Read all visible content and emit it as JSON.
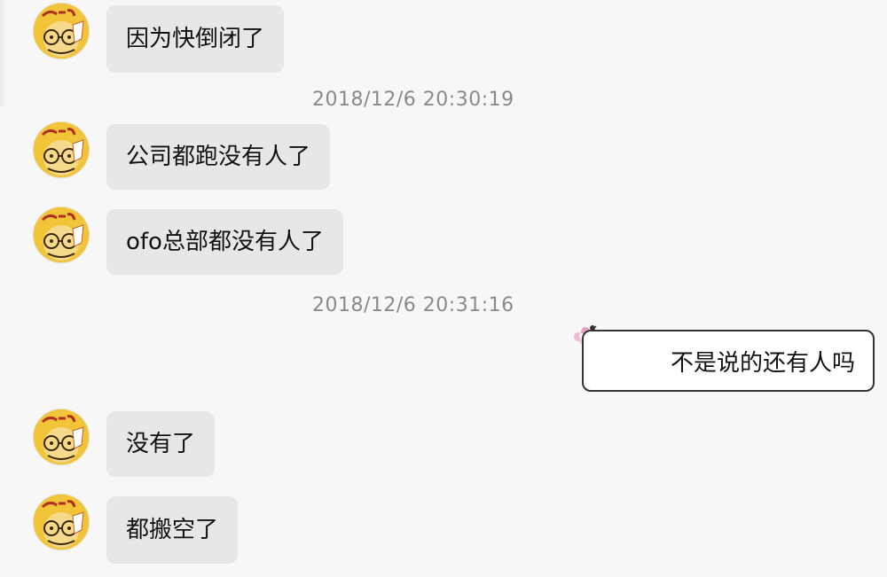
{
  "conversation": {
    "messages": [
      {
        "sender": "other",
        "text": "因为快倒闭了"
      },
      {
        "type": "timestamp",
        "text": "2018/12/6 20:30:19"
      },
      {
        "sender": "other",
        "text": "公司都跑没有人了"
      },
      {
        "sender": "other",
        "text": "ofo总部都没有人了"
      },
      {
        "type": "timestamp",
        "text": "2018/12/6 20:31:16"
      },
      {
        "sender": "self",
        "text": "不是说的还有人吗"
      },
      {
        "sender": "other",
        "text": "没有了"
      },
      {
        "sender": "other",
        "text": "都搬空了"
      }
    ]
  },
  "colors": {
    "background": "#f7f7f8",
    "incoming_bubble": "#e7e7ea",
    "outgoing_bubble": "#ffffff",
    "outgoing_border": "#333333",
    "timestamp_text": "#8a8a8a",
    "avatar_yellow": "#f2c43a"
  },
  "icons": {
    "other_avatar": "cartoon-dog-avatar",
    "self_decoration": "flower-icon"
  }
}
